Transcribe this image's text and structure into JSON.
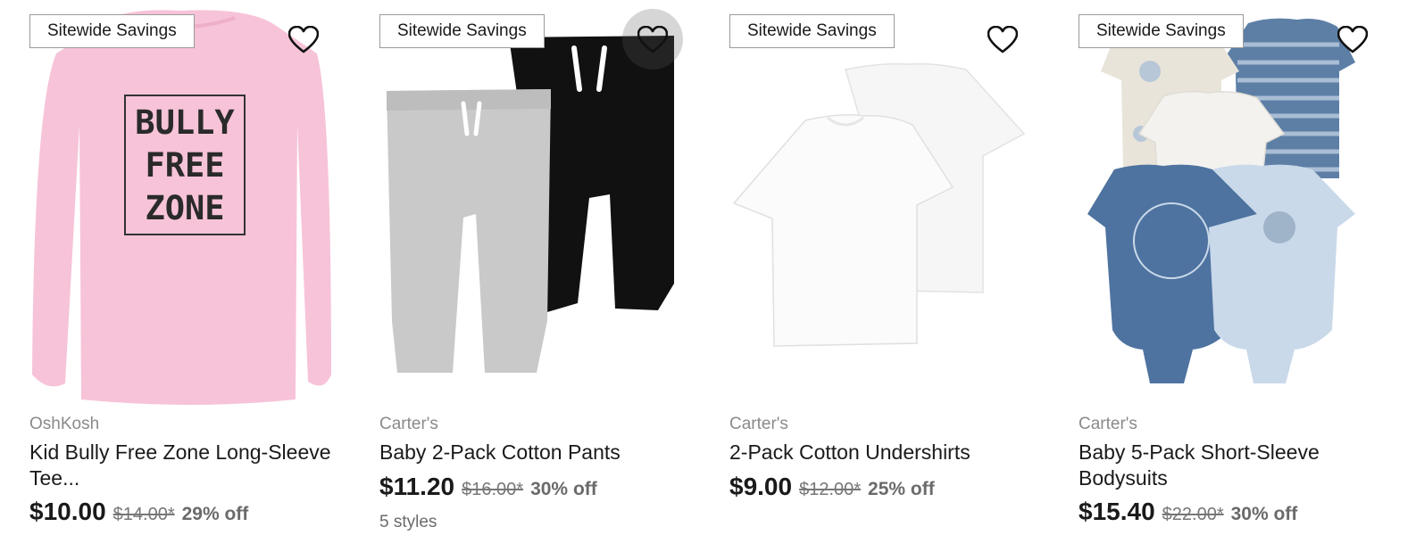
{
  "products": [
    {
      "badge": "Sitewide Savings",
      "brand": "OshKosh",
      "title": "Kid Bully Free Zone Long-Sleeve Tee...",
      "price": "$10.00",
      "original_price": "$14.00*",
      "discount": "29% off",
      "graphic_text": [
        "BULLY",
        "FREE",
        "ZONE"
      ],
      "image_icon": "pink-long-sleeve-tee"
    },
    {
      "badge": "Sitewide Savings",
      "brand": "Carter's",
      "title": "Baby 2-Pack Cotton Pants",
      "price": "$11.20",
      "original_price": "$16.00*",
      "discount": "30% off",
      "styles": "5 styles",
      "image_icon": "gray-black-pants-pack"
    },
    {
      "badge": "Sitewide Savings",
      "brand": "Carter's",
      "title": "2-Pack Cotton Undershirts",
      "price": "$9.00",
      "original_price": "$12.00*",
      "discount": "25% off",
      "image_icon": "white-undershirts-pack"
    },
    {
      "badge": "Sitewide Savings",
      "brand": "Carter's",
      "title": "Baby 5-Pack Short-Sleeve Bodysuits",
      "price": "$15.40",
      "original_price": "$22.00*",
      "discount": "30% off",
      "image_icon": "blue-bodysuits-pack"
    }
  ],
  "colors": {
    "pink_tee": "#f7c3d8",
    "gray_pants": "#c9c9c9",
    "black_pants": "#111111",
    "navy_bodysuit": "#4e73a0",
    "light_blue_bodysuit": "#c9d9ea"
  }
}
